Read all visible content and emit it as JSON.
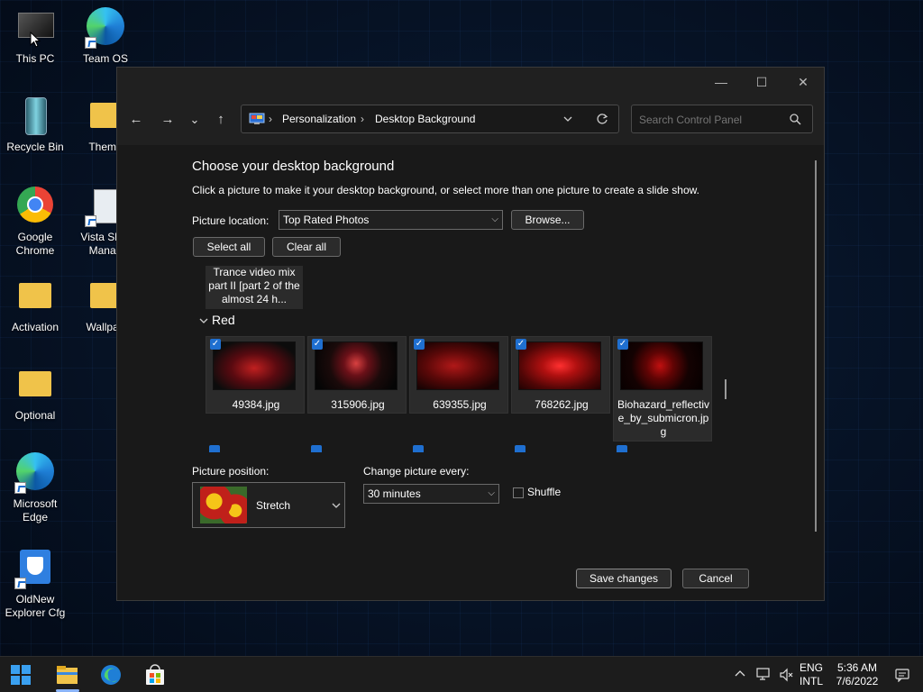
{
  "desktop": {
    "icons": [
      {
        "label": "This PC"
      },
      {
        "label": "Team OS"
      },
      {
        "label": "Recycle Bin"
      },
      {
        "label": "Theme"
      },
      {
        "label": "Google Chrome"
      },
      {
        "label": "Vista Shor Manag"
      },
      {
        "label": "Activation"
      },
      {
        "label": "Wallpap"
      },
      {
        "label": "Optional"
      },
      {
        "label": "Microsoft Edge"
      },
      {
        "label": "OldNew Explorer Cfg"
      }
    ]
  },
  "window": {
    "controls": {
      "minimize": "—",
      "maximize": "☐",
      "close": "✕"
    },
    "nav": {
      "back": "←",
      "forward": "→",
      "recent": "⌄",
      "up": "↑"
    },
    "breadcrumb": [
      "Personalization",
      "Desktop Background"
    ],
    "breadcrumb_sep": "›",
    "search_placeholder": "Search Control Panel",
    "heading": "Choose your desktop background",
    "subtext": "Click a picture to make it your desktop background, or select more than one picture to create a slide show.",
    "picture_location_label": "Picture location:",
    "picture_location_value": "Top Rated Photos",
    "browse_label": "Browse...",
    "select_all_label": "Select all",
    "clear_all_label": "Clear all",
    "prev_item_caption": "Trance video mix part II [part 2 of the almost 24 h...",
    "group_name": "Red",
    "thumbnails": [
      {
        "caption": "49384.jpg",
        "checked": true
      },
      {
        "caption": "315906.jpg",
        "checked": true
      },
      {
        "caption": "639355.jpg",
        "checked": true
      },
      {
        "caption": "768262.jpg",
        "checked": true
      },
      {
        "caption": "Biohazard_reflective_by_submicron.jpg",
        "checked": true
      }
    ],
    "picture_position_label": "Picture position:",
    "picture_position_value": "Stretch",
    "change_every_label": "Change picture every:",
    "change_every_value": "30 minutes",
    "shuffle_label": "Shuffle",
    "shuffle_checked": false,
    "save_label": "Save changes",
    "cancel_label": "Cancel"
  },
  "taskbar": {
    "lang_top": "ENG",
    "lang_bottom": "INTL",
    "time": "5:36 AM",
    "date": "7/6/2022",
    "apps": [
      "start-icon",
      "file-explorer-icon",
      "edge-icon",
      "store-icon"
    ]
  },
  "colors": {
    "accent": "#1f6fd0",
    "window_bg": "#202020",
    "content_bg": "#191919"
  }
}
